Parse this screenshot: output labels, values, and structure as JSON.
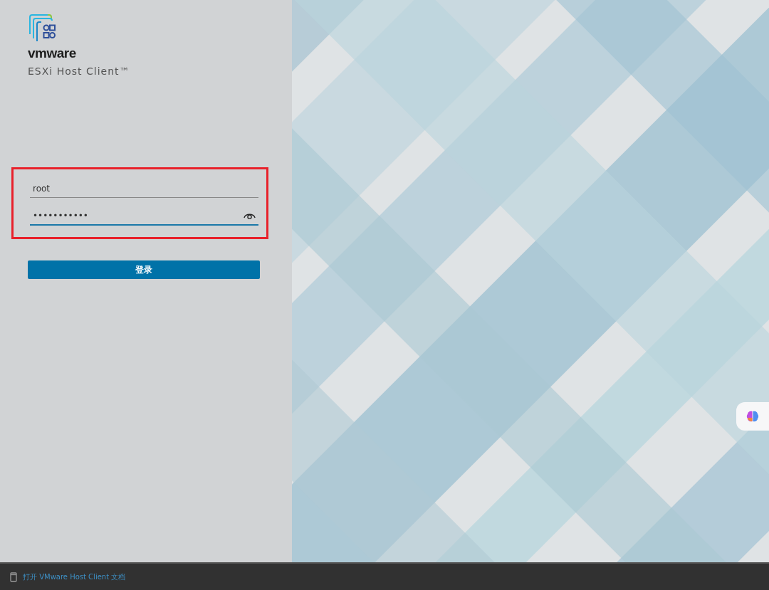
{
  "brand": {
    "logo_text": "vmware",
    "product": "ESXi Host Client™"
  },
  "login_form": {
    "highlighted": true,
    "fields": [
      {
        "kind": "text",
        "value": "root",
        "focused": false
      },
      {
        "kind": "password",
        "value": "•••••••••••",
        "focused": true
      }
    ],
    "submit_button": "登录"
  },
  "footer": {
    "link": "打开 VMware Host Client 文档"
  },
  "floating_button": {
    "kind": "assistant"
  }
}
